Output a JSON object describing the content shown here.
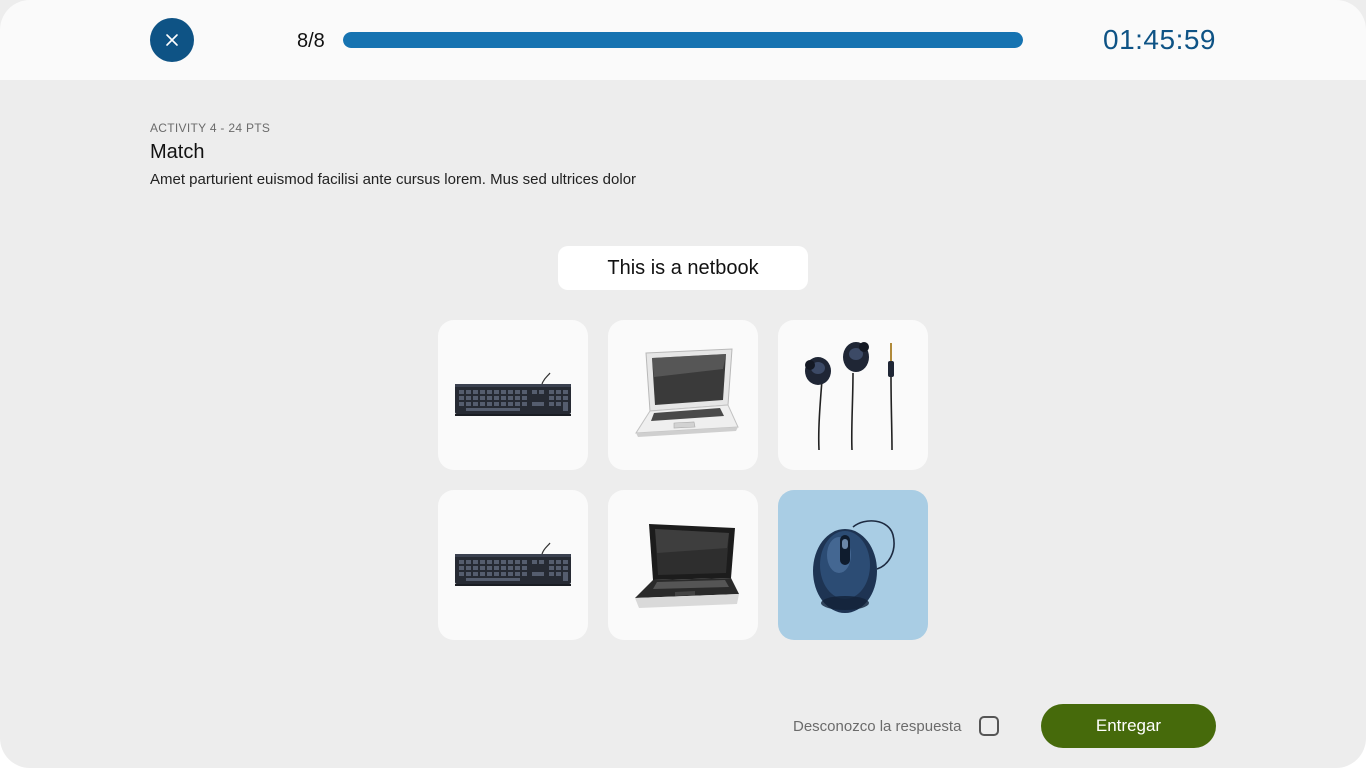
{
  "header": {
    "counter": "8/8",
    "progress_fraction": 1.0,
    "timer": "01:45:59",
    "close_icon": "close-icon",
    "accent_color": "#0e5385",
    "progress_color": "#1673b1"
  },
  "activity": {
    "meta": "ACTIVITY 4 - 24 PTS",
    "title": "Match",
    "description": "Amet parturient euismod facilisi ante cursus lorem. Mus sed ultrices dolor"
  },
  "prompt": {
    "text": "This is a netbook"
  },
  "options": [
    {
      "image": "keyboard",
      "selected": false
    },
    {
      "image": "netbook-white",
      "selected": false
    },
    {
      "image": "earphones",
      "selected": false
    },
    {
      "image": "keyboard",
      "selected": false
    },
    {
      "image": "netbook-black",
      "selected": false
    },
    {
      "image": "mouse",
      "selected": true
    }
  ],
  "footer": {
    "unknown_label": "Desconozco la respuesta",
    "unknown_checked": false,
    "submit_label": "Entregar",
    "submit_color": "#466a0b"
  }
}
